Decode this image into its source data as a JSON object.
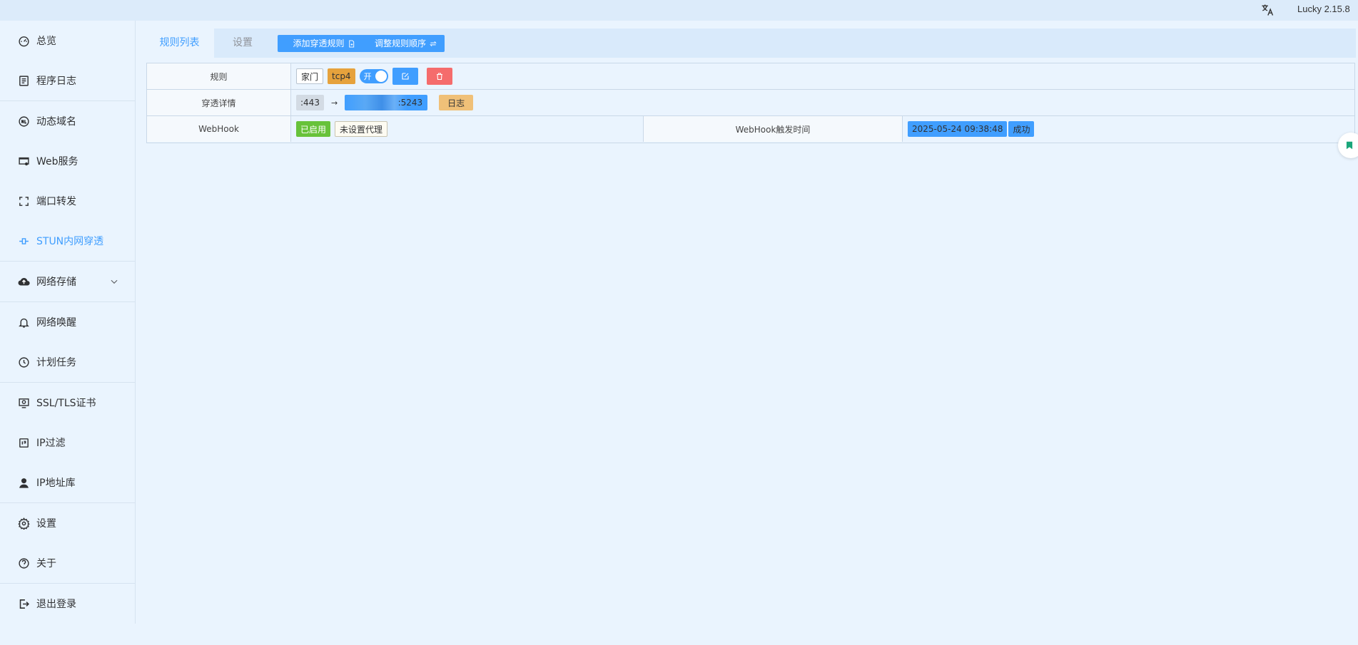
{
  "header": {
    "version": "Lucky 2.15.8",
    "lang_icon": "translate-icon"
  },
  "sidebar": {
    "items": [
      {
        "label": "总览",
        "icon": "dashboard-icon"
      },
      {
        "label": "程序日志",
        "icon": "log-icon"
      },
      {
        "label": "动态域名",
        "icon": "ddns-icon"
      },
      {
        "label": "Web服务",
        "icon": "web-service-icon"
      },
      {
        "label": "端口转发",
        "icon": "port-forward-icon"
      },
      {
        "label": "STUN内网穿透",
        "icon": "stun-icon",
        "active": true
      },
      {
        "label": "网络存储",
        "icon": "cloud-icon"
      },
      {
        "label": "网络唤醒",
        "icon": "bell-icon"
      },
      {
        "label": "计划任务",
        "icon": "clock-icon"
      },
      {
        "label": "SSL/TLS证书",
        "icon": "certificate-icon"
      },
      {
        "label": "IP过滤",
        "icon": "filter-icon"
      },
      {
        "label": "IP地址库",
        "icon": "user-location-icon"
      },
      {
        "label": "设置",
        "icon": "gear-icon"
      },
      {
        "label": "关于",
        "icon": "about-icon"
      },
      {
        "label": "退出登录",
        "icon": "logout-icon"
      }
    ]
  },
  "tabs": {
    "list": "规则列表",
    "settings": "设置"
  },
  "toolbar": {
    "add_rule": "添加穿透规则",
    "reorder": "调整规则顺序"
  },
  "rule": {
    "rule_label": "规则",
    "name": "家门",
    "protocol": "tcp4",
    "switch_text": "开",
    "detail_label": "穿透详情",
    "local_port": ":443",
    "arrow": "→",
    "public_addr_suffix": ":5243",
    "log_button": "日志",
    "webhook_label": "WebHook",
    "webhook_enabled": "已启用",
    "webhook_proxy": "未设置代理",
    "webhook_time_label": "WebHook触发时间",
    "webhook_time": "2025-05-24 09:38:48",
    "webhook_result": "成功"
  },
  "colors": {
    "accent": "#409eff",
    "danger": "#f56c6c",
    "warning": "#e6a23c",
    "success": "#67c23a"
  }
}
